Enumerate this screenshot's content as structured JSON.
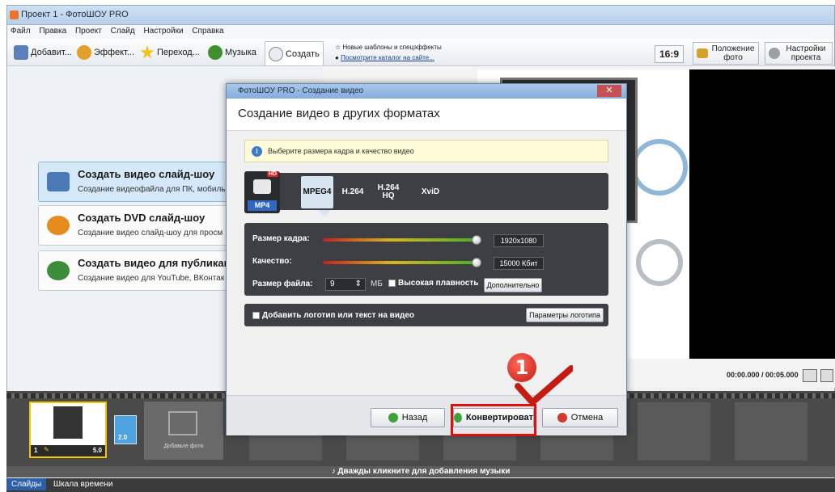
{
  "window": {
    "title": "Проект 1 - ФотоШОУ PRO"
  },
  "menu": [
    "Файл",
    "Правка",
    "Проект",
    "Слайд",
    "Настройки",
    "Справка"
  ],
  "toolbar": {
    "tabs": [
      {
        "label": "Добавит...",
        "icon": "add-photo-icon"
      },
      {
        "label": "Эффект...",
        "icon": "effects-icon"
      },
      {
        "label": "Переход...",
        "icon": "star-icon"
      },
      {
        "label": "Музыка",
        "icon": "music-icon"
      },
      {
        "label": "Создать",
        "icon": "disc-icon"
      }
    ],
    "news_line1": "Новые шаблоны и спецэффекты",
    "news_line2": "Посмотрите каталог на сайте...",
    "ratio": "16:9",
    "position_label": "Положение фото",
    "settings_label": "Настройки проекта"
  },
  "left_cards": [
    {
      "title": "Создать видео слайд-шоу",
      "subtitle": "Создание видеофайла для ПК, мобиль"
    },
    {
      "title": "Создать DVD слайд-шоу",
      "subtitle": "Создание видео слайд-шоу для просм"
    },
    {
      "title": "Создать видео для публикац",
      "subtitle": "Создание видео для YouTube, ВКонтак"
    }
  ],
  "preview": {
    "time": "00:00.000 / 00:05.000"
  },
  "strip": {
    "slide_number": "1",
    "slide_duration": "5.0",
    "transition_duration": "2.0",
    "add_photo_label": "Добавьте фото",
    "music_hint": "Дважды кликните для добавления музыки"
  },
  "bottom_tabs": [
    "Слайды",
    "Шкала времени"
  ],
  "dialog": {
    "title": "ФотоШОУ PRO - Создание видео",
    "header": "Создание видео в других форматах",
    "hint": "Выберите размера кадра и качество видео",
    "format_badge": "MP4",
    "hd_badge": "HD",
    "formats": [
      "MPEG4",
      "H.264",
      "H.264 HQ",
      "XviD"
    ],
    "selected_format": "MPEG4",
    "frame_size_label": "Размер кадра:",
    "frame_size_value": "1920x1080",
    "frame_size_level": 1.0,
    "quality_label": "Качество:",
    "quality_value": "15000 Кбит",
    "quality_level": 1.0,
    "file_size_label": "Размер файла:",
    "file_size_value": "9",
    "file_size_unit": "МБ",
    "smooth_label": "Высокая плавность",
    "more_button": "Дополнительно",
    "logo_checkbox": "Добавить логотип или текст на видео",
    "logo_params_button": "Параметры логотипа",
    "back_button": "Назад",
    "convert_button": "Конвертироват",
    "cancel_button": "Отмена"
  },
  "annotation": {
    "step_number": "1",
    "highlight_color": "#e01010"
  }
}
